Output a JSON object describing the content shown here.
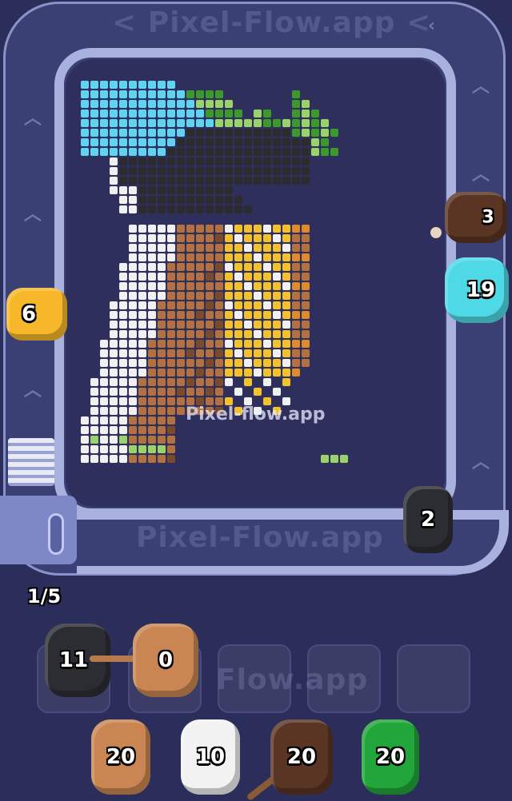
{
  "watermark": {
    "top": "< Pixel-Flow.app <",
    "bottom": "Pixel-Flow.app",
    "center": "Pixel-flow.app",
    "slots": "Flow.app"
  },
  "progress": "1/5",
  "conveyor_shooters": [
    {
      "id": "yellow",
      "count": "6",
      "color": "#f6b82a"
    },
    {
      "id": "dark-brown",
      "count": "3",
      "color": "#5b3524"
    },
    {
      "id": "cyan",
      "count": "19",
      "color": "#4fd8e6"
    },
    {
      "id": "black",
      "count": "2",
      "color": "#2c2c33"
    }
  ],
  "queue_slots": [
    {
      "count": "11",
      "color": "#2c2c33",
      "filled": true
    },
    {
      "count": "0",
      "color": "#c98652",
      "filled": true
    },
    {
      "filled": false
    },
    {
      "filled": false
    },
    {
      "filled": false
    }
  ],
  "waiting_shooters": [
    {
      "count": "20",
      "color": "#c98652"
    },
    {
      "count": "10",
      "color": "#f2f2f2"
    },
    {
      "count": "20",
      "color": "#5b3524"
    },
    {
      "count": "20",
      "color": "#22a53a"
    }
  ],
  "colors": {
    "background": "#2b2e5a",
    "board": "#2f2f5e",
    "rail": "#a9b1de",
    "cyan": "#5fd3f2",
    "green_light": "#9ad36a",
    "green_dark": "#3b9a2a",
    "black": "#2c2c2e",
    "white": "#f0f0f0",
    "brown": "#b3713f",
    "dark_brown": "#7a4a2a",
    "yellow": "#f3c22a",
    "orange": "#e08a2a"
  }
}
